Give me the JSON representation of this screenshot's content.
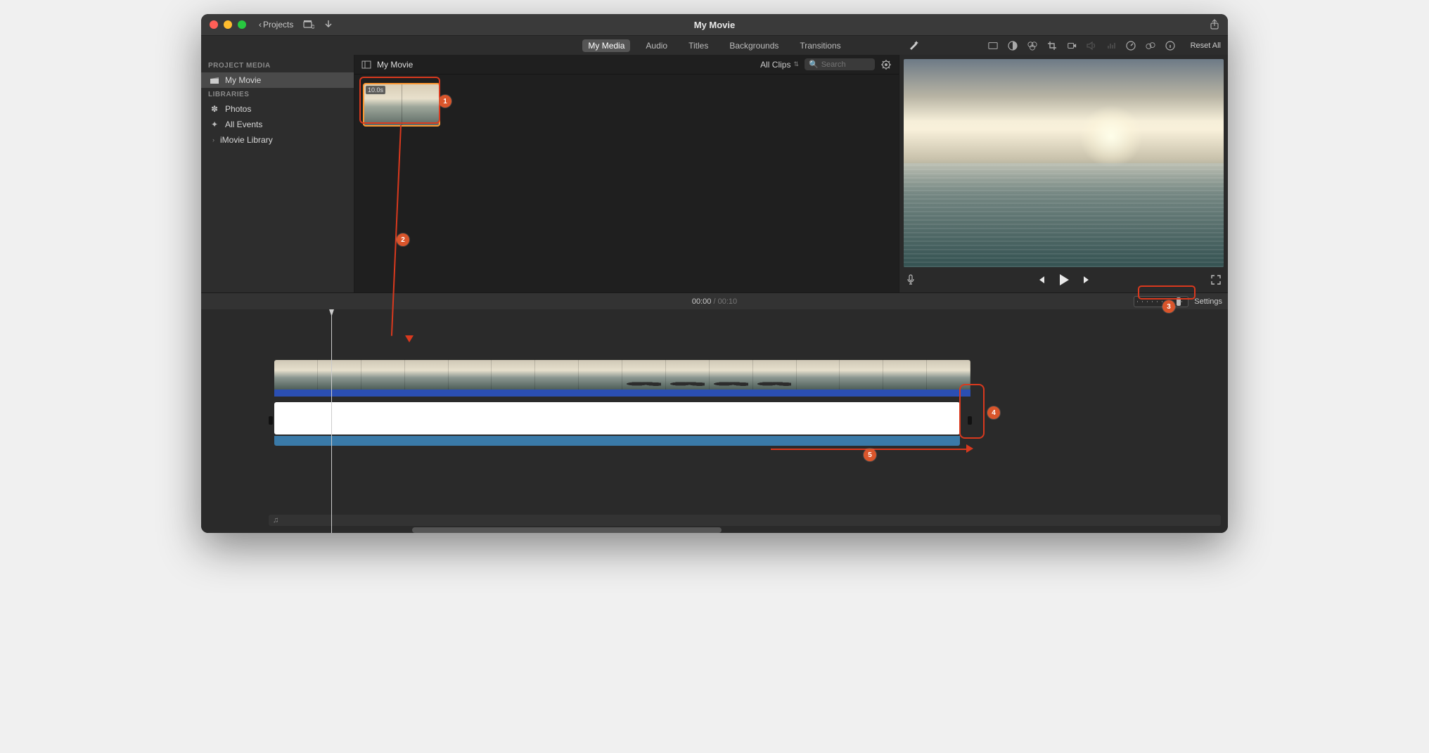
{
  "window": {
    "title": "My Movie"
  },
  "titlebar": {
    "projects_label": "Projects"
  },
  "tabs": {
    "my_media": "My Media",
    "audio": "Audio",
    "titles": "Titles",
    "backgrounds": "Backgrounds",
    "transitions": "Transitions"
  },
  "reset_all": "Reset All",
  "sidebar": {
    "project_media_header": "PROJECT MEDIA",
    "project_item": "My Movie",
    "libraries_header": "LIBRARIES",
    "photos": "Photos",
    "all_events": "All Events",
    "imovie_library": "iMovie Library"
  },
  "browser": {
    "title": "My Movie",
    "all_clips": "All Clips",
    "search_placeholder": "Search",
    "clip_duration": "10.0s"
  },
  "timeline": {
    "current": "00:00",
    "total": "00:10",
    "settings_label": "Settings"
  },
  "annotations": {
    "b1": "1",
    "b2": "2",
    "b3": "3",
    "b4": "4",
    "b5": "5"
  }
}
